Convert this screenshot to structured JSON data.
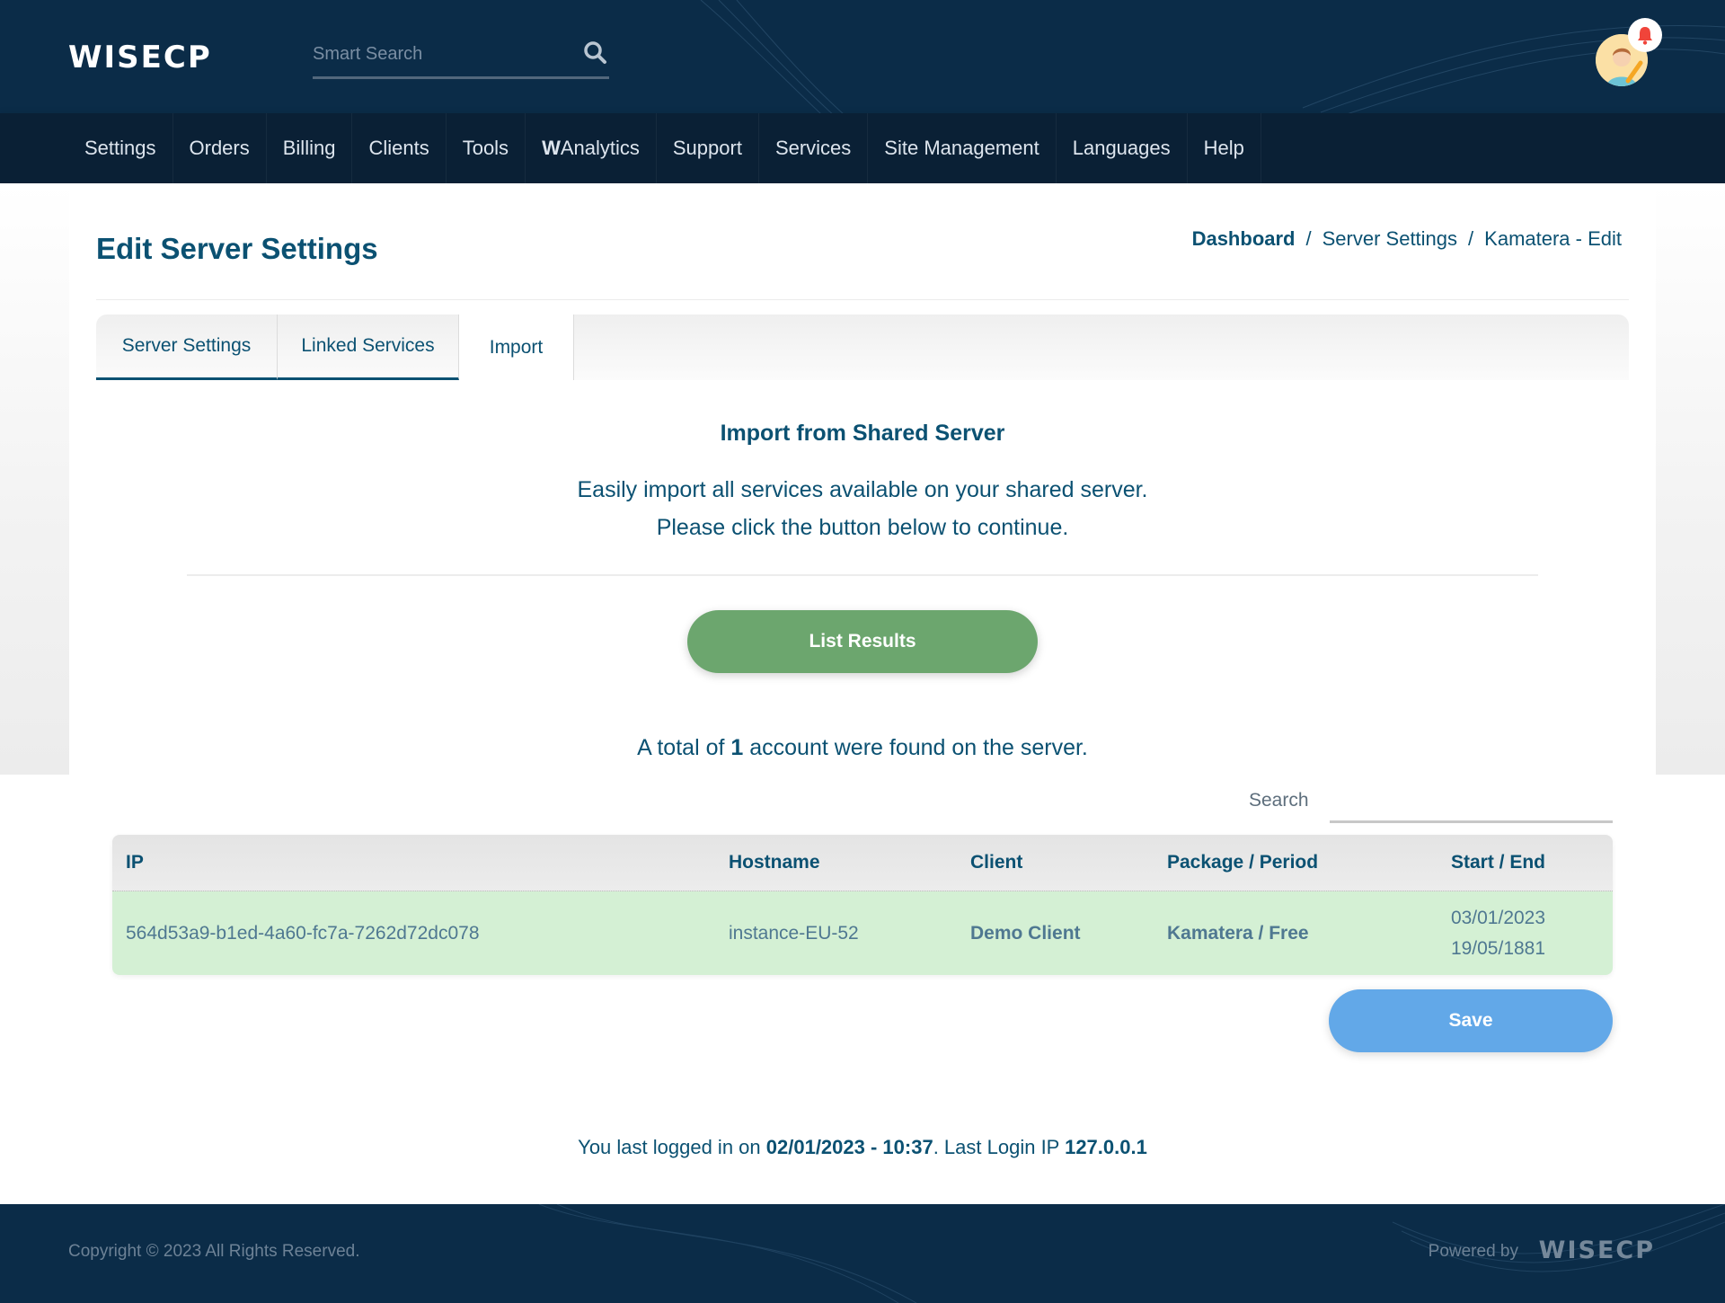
{
  "header": {
    "logo": "WISECP",
    "search_placeholder": "Smart Search",
    "search_value": ""
  },
  "nav": {
    "items": [
      {
        "label": "Settings"
      },
      {
        "label": "Orders"
      },
      {
        "label": "Billing"
      },
      {
        "label": "Clients"
      },
      {
        "label": "Tools"
      },
      {
        "label_bold": "W",
        "label": "Analytics"
      },
      {
        "label": "Support"
      },
      {
        "label": "Services"
      },
      {
        "label": "Site Management"
      },
      {
        "label": "Languages"
      },
      {
        "label": "Help"
      }
    ]
  },
  "page": {
    "title": "Edit Server Settings",
    "breadcrumb": [
      {
        "label": "Dashboard"
      },
      {
        "label": "Server Settings"
      },
      {
        "label": "Kamatera - Edit"
      }
    ],
    "breadcrumb_separator": "/"
  },
  "tabs": [
    {
      "label": "Server Settings",
      "active": false
    },
    {
      "label": "Linked Services",
      "active": false
    },
    {
      "label": "Import",
      "active": true
    }
  ],
  "import": {
    "title": "Import from Shared Server",
    "desc_line1": "Easily import all services available on your shared server.",
    "desc_line2": "Please click the button below to continue.",
    "list_button": "List Results",
    "total_prefix": "A total of",
    "total_count": "1",
    "total_suffix": "account were found on the server."
  },
  "table": {
    "search_label": "Search",
    "search_value": "",
    "columns": [
      "IP",
      "Hostname",
      "Client",
      "Package / Period",
      "Start / End"
    ],
    "rows": [
      {
        "ip": "564d53a9-b1ed-4a60-fc7a-7262d72dc078",
        "hostname": "instance-EU-52",
        "client": "Demo Client",
        "package": "Kamatera / Free",
        "start": "03/01/2023",
        "end": "19/05/1881"
      }
    ],
    "row_color": "#d4f0d4"
  },
  "save_button": "Save",
  "last_login": {
    "prefix": "You last logged in on",
    "datetime": "02/01/2023 - 10:37",
    "middle": ". Last Login IP",
    "ip": "127.0.0.1"
  },
  "footer": {
    "copyright": "Copyright © 2023 All Rights Reserved.",
    "powered_by": "Powered by",
    "logo": "WISECP"
  },
  "colors": {
    "brand_dark": "#0b2c48",
    "text_primary": "#0b5172",
    "list_button": "#6ca66e",
    "save_button": "#62a8e8",
    "notification": "#f0443a"
  }
}
